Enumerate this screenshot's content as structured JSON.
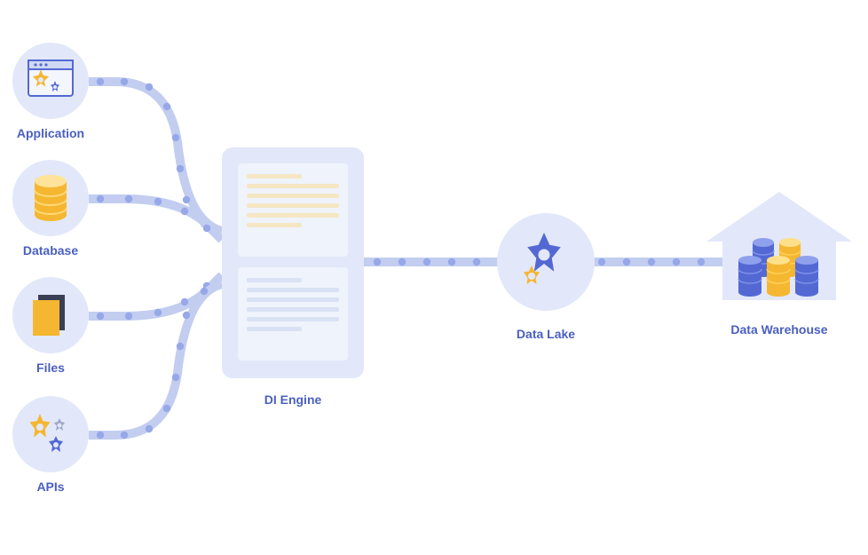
{
  "diagram": {
    "sources": [
      {
        "label": "Application"
      },
      {
        "label": "Database"
      },
      {
        "label": "Files"
      },
      {
        "label": "APIs"
      }
    ],
    "engine": {
      "label": "DI Engine"
    },
    "lake": {
      "label": "Data Lake"
    },
    "warehouse": {
      "label": "Data Warehouse"
    }
  },
  "colors": {
    "node_bg": "#e2e8f9",
    "label": "#4a5fc0",
    "accent_blue": "#5468d4",
    "accent_yellow": "#f5b731",
    "accent_grey": "#9aa7c7",
    "path": "#c2cdf0",
    "dot": "#97a8e8"
  }
}
